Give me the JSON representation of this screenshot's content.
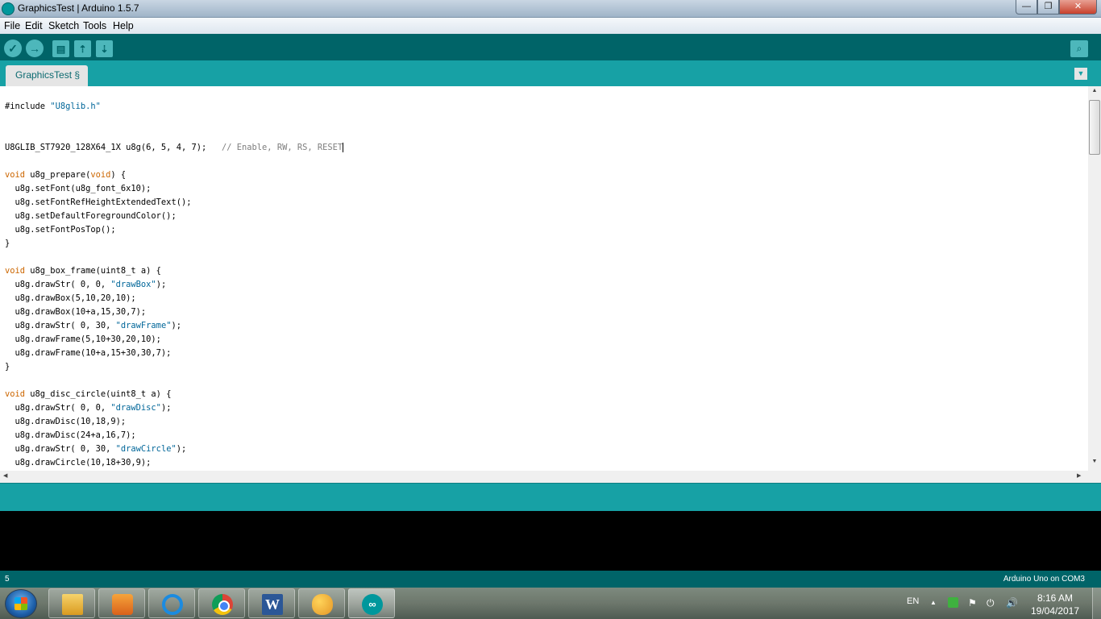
{
  "window": {
    "title": "GraphicsTest | Arduino 1.5.7",
    "min_glyph": "—",
    "max_glyph": "❐",
    "close_glyph": "✕"
  },
  "menu": [
    "File",
    "Edit",
    "Sketch",
    "Tools",
    "Help"
  ],
  "toolbar": {
    "verify_glyph": "✓",
    "upload_glyph": "→",
    "new_glyph": "▤",
    "open_glyph": "⇡",
    "save_glyph": "⇣",
    "serial_glyph": "⌕",
    "icons": [
      "check-icon",
      "arrow-right-icon",
      "new-file-icon",
      "open-icon",
      "save-icon",
      "serial-monitor-icon"
    ]
  },
  "tabs": [
    {
      "label": "GraphicsTest §"
    }
  ],
  "tab_menu_glyph": "▼",
  "editor": {
    "code": [
      {
        "segs": [
          {
            "t": "#include ",
            "c": ""
          },
          {
            "t": "\"U8glib.h\"",
            "c": "str"
          }
        ]
      },
      {
        "segs": []
      },
      {
        "segs": []
      },
      {
        "segs": [
          {
            "t": "U8GLIB_ST7920_128X64_1X u8g(6, 5, 4, 7);   ",
            "c": ""
          },
          {
            "t": "// Enable, RW, RS, RESET",
            "c": "cmt"
          }
        ],
        "caret": true
      },
      {
        "segs": []
      },
      {
        "segs": [
          {
            "t": "void",
            "c": "kw"
          },
          {
            "t": " u8g_prepare(",
            "c": ""
          },
          {
            "t": "void",
            "c": "kw"
          },
          {
            "t": ") {",
            "c": ""
          }
        ]
      },
      {
        "segs": [
          {
            "t": "  u8g.setFont(u8g_font_6x10);",
            "c": ""
          }
        ]
      },
      {
        "segs": [
          {
            "t": "  u8g.setFontRefHeightExtendedText();",
            "c": ""
          }
        ]
      },
      {
        "segs": [
          {
            "t": "  u8g.setDefaultForegroundColor();",
            "c": ""
          }
        ]
      },
      {
        "segs": [
          {
            "t": "  u8g.setFontPosTop();",
            "c": ""
          }
        ]
      },
      {
        "segs": [
          {
            "t": "}",
            "c": ""
          }
        ]
      },
      {
        "segs": []
      },
      {
        "segs": [
          {
            "t": "void",
            "c": "kw"
          },
          {
            "t": " u8g_box_frame(uint8_t a) {",
            "c": ""
          }
        ]
      },
      {
        "segs": [
          {
            "t": "  u8g.drawStr( 0, 0, ",
            "c": ""
          },
          {
            "t": "\"drawBox\"",
            "c": "str"
          },
          {
            "t": ");",
            "c": ""
          }
        ]
      },
      {
        "segs": [
          {
            "t": "  u8g.drawBox(5,10,20,10);",
            "c": ""
          }
        ]
      },
      {
        "segs": [
          {
            "t": "  u8g.drawBox(10+a,15,30,7);",
            "c": ""
          }
        ]
      },
      {
        "segs": [
          {
            "t": "  u8g.drawStr( 0, 30, ",
            "c": ""
          },
          {
            "t": "\"drawFrame\"",
            "c": "str"
          },
          {
            "t": ");",
            "c": ""
          }
        ]
      },
      {
        "segs": [
          {
            "t": "  u8g.drawFrame(5,10+30,20,10);",
            "c": ""
          }
        ]
      },
      {
        "segs": [
          {
            "t": "  u8g.drawFrame(10+a,15+30,30,7);",
            "c": ""
          }
        ]
      },
      {
        "segs": [
          {
            "t": "}",
            "c": ""
          }
        ]
      },
      {
        "segs": []
      },
      {
        "segs": [
          {
            "t": "void",
            "c": "kw"
          },
          {
            "t": " u8g_disc_circle(uint8_t a) {",
            "c": ""
          }
        ]
      },
      {
        "segs": [
          {
            "t": "  u8g.drawStr( 0, 0, ",
            "c": ""
          },
          {
            "t": "\"drawDisc\"",
            "c": "str"
          },
          {
            "t": ");",
            "c": ""
          }
        ]
      },
      {
        "segs": [
          {
            "t": "  u8g.drawDisc(10,18,9);",
            "c": ""
          }
        ]
      },
      {
        "segs": [
          {
            "t": "  u8g.drawDisc(24+a,16,7);",
            "c": ""
          }
        ]
      },
      {
        "segs": [
          {
            "t": "  u8g.drawStr( 0, 30, ",
            "c": ""
          },
          {
            "t": "\"drawCircle\"",
            "c": "str"
          },
          {
            "t": ");",
            "c": ""
          }
        ]
      },
      {
        "segs": [
          {
            "t": "  u8g.drawCircle(10,18+30,9);",
            "c": ""
          }
        ]
      }
    ]
  },
  "scroll": {
    "up_glyph": "▲",
    "down_glyph": "▼",
    "left_glyph": "◀",
    "right_glyph": "▶"
  },
  "status": {
    "line_number": "5",
    "board": "Arduino Uno on COM3"
  },
  "taskbar": {
    "apps": [
      {
        "name": "explorer",
        "icon": "folder-icon",
        "cls": "ico-explorer",
        "glyph": ""
      },
      {
        "name": "media",
        "icon": "media-player-icon",
        "cls": "ico-media",
        "glyph": ""
      },
      {
        "name": "ie",
        "icon": "internet-explorer-icon",
        "cls": "ico-ie",
        "glyph": ""
      },
      {
        "name": "chrome",
        "icon": "chrome-icon",
        "cls": "ico-chrome",
        "glyph": ""
      },
      {
        "name": "word",
        "icon": "word-icon",
        "cls": "ico-word",
        "glyph": "W"
      },
      {
        "name": "paint",
        "icon": "paint-icon",
        "cls": "ico-paint",
        "glyph": ""
      },
      {
        "name": "arduino",
        "icon": "arduino-icon",
        "cls": "ico-arduino",
        "glyph": "∞",
        "active": true
      }
    ],
    "lang": "EN",
    "time": "8:16 AM",
    "date": "19/04/2017"
  }
}
